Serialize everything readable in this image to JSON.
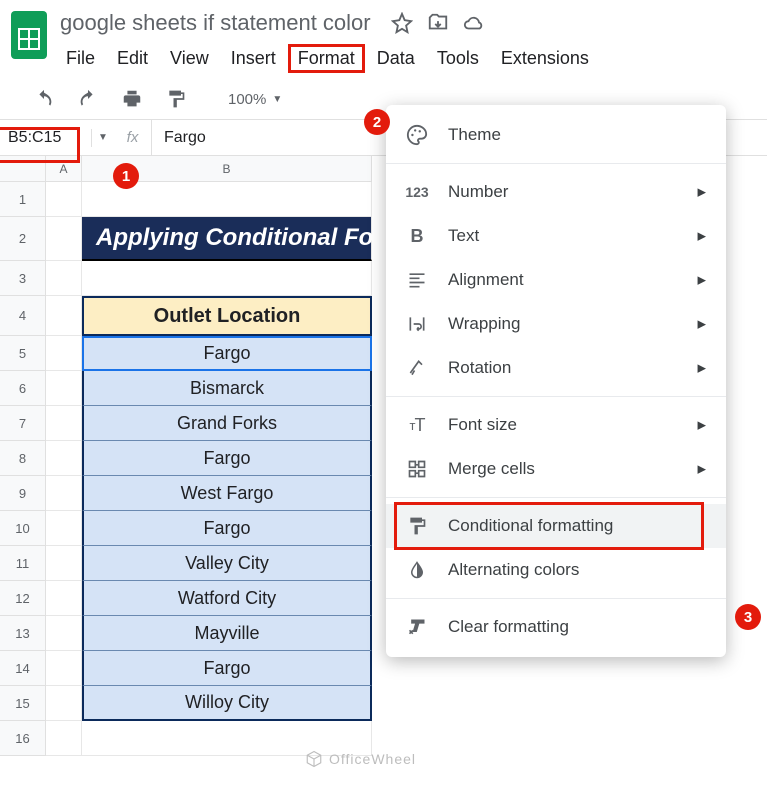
{
  "doc": {
    "title": "google sheets if statement color"
  },
  "menubar": [
    "File",
    "Edit",
    "View",
    "Insert",
    "Format",
    "Data",
    "Tools",
    "Extensions"
  ],
  "toolbar": {
    "zoom": "100%"
  },
  "namebox": "B5:C15",
  "formula": "Fargo",
  "columns": [
    "A",
    "B"
  ],
  "rows": [
    1,
    2,
    3,
    4,
    5,
    6,
    7,
    8,
    9,
    10,
    11,
    12,
    13,
    14,
    15,
    16
  ],
  "banner": "Applying Conditional Formatting",
  "section_header": "Outlet Location",
  "data_cells": [
    "Fargo",
    "Bismarck",
    "Grand Forks",
    "Fargo",
    "West Fargo",
    "Fargo",
    "Valley City",
    "Watford City",
    "Mayville",
    "Fargo",
    "Willoy City"
  ],
  "menu": {
    "theme": "Theme",
    "number": "Number",
    "text": "Text",
    "alignment": "Alignment",
    "wrapping": "Wrapping",
    "rotation": "Rotation",
    "fontsize": "Font size",
    "merge": "Merge cells",
    "conditional": "Conditional formatting",
    "alternating": "Alternating colors",
    "clear": "Clear formatting"
  },
  "steps": {
    "s1": "1",
    "s2": "2",
    "s3": "3"
  },
  "watermark": "OfficeWheel"
}
